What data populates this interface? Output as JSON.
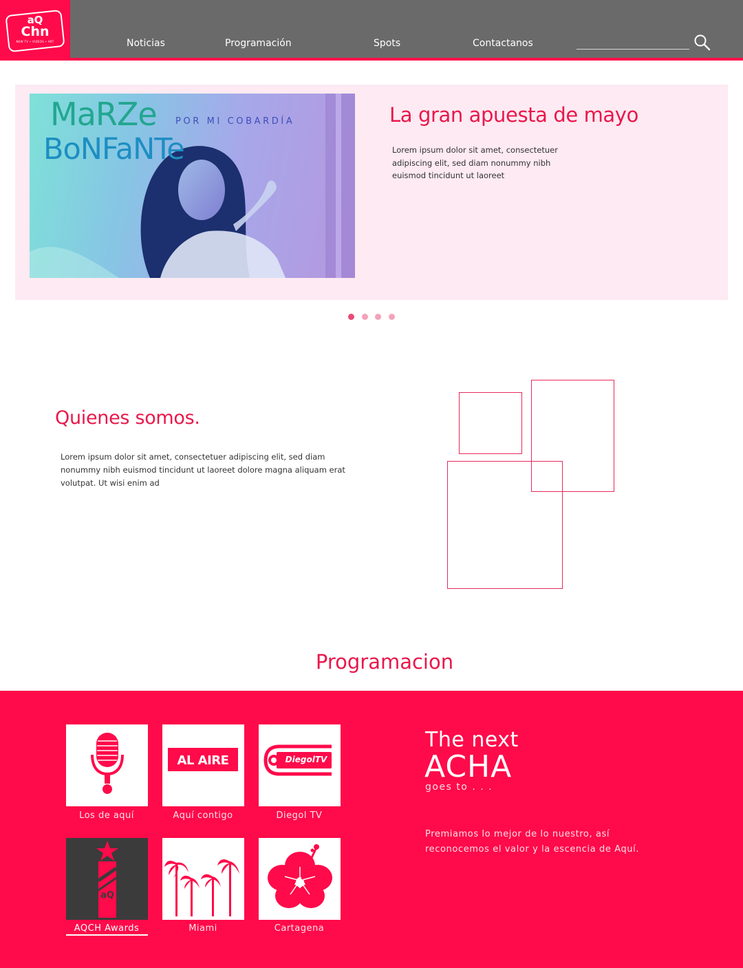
{
  "brand": {
    "logo_top": "aQ",
    "logo_main": "Chn",
    "logo_sub": "NEW TV • VIDEOS • ART",
    "accent": "#ff0a4a",
    "header_bg": "#6a6a6a"
  },
  "nav": {
    "items": [
      {
        "label": "Noticias"
      },
      {
        "label": "Programación"
      },
      {
        "label": "Spots"
      },
      {
        "label": "Contactanos"
      }
    ],
    "search_value": "",
    "search_icon": "search-icon"
  },
  "hero": {
    "image": {
      "artist_line1": "MaRZe",
      "artist_line2": "BoNFaNTe",
      "song": "POR MI COBARDÍA"
    },
    "title": "La gran apuesta de mayo",
    "text": "Lorem ipsum dolor sit amet, consectetuer adipiscing elit, sed diam nonummy nibh euismod tincidunt ut laoreet",
    "slide_count": 4,
    "active_slide": 1
  },
  "about": {
    "title": "Quienes somos.",
    "text": "Lorem ipsum dolor sit amet, consectetuer adipiscing elit, sed diam nonummy nibh euismod tincidunt ut laoreet dolore magna aliquam erat volutpat. Ut wisi enim ad"
  },
  "programacion": {
    "title": "Programacion",
    "tiles": [
      {
        "label": "Los de aquí",
        "icon": "microphone-icon"
      },
      {
        "label": "Aquí contigo",
        "icon": "al-aire-icon",
        "icon_text": "AL AIRE"
      },
      {
        "label": "Diegol TV",
        "icon": "diegoltv-logo-icon",
        "icon_text": "DiegolTV"
      },
      {
        "label": "AQCH Awards",
        "icon": "award-trophy-icon",
        "icon_text": "aQ"
      },
      {
        "label": "Miami",
        "icon": "palm-trees-icon"
      },
      {
        "label": "Cartagena",
        "icon": "hibiscus-flower-icon"
      }
    ],
    "acha": {
      "line1": "The next",
      "line2": "ACHA",
      "line3": "goes to . . .",
      "text": "Premiamos lo mejor de lo nuestro, así reconocemos el valor y la escencia de Aquí."
    }
  }
}
